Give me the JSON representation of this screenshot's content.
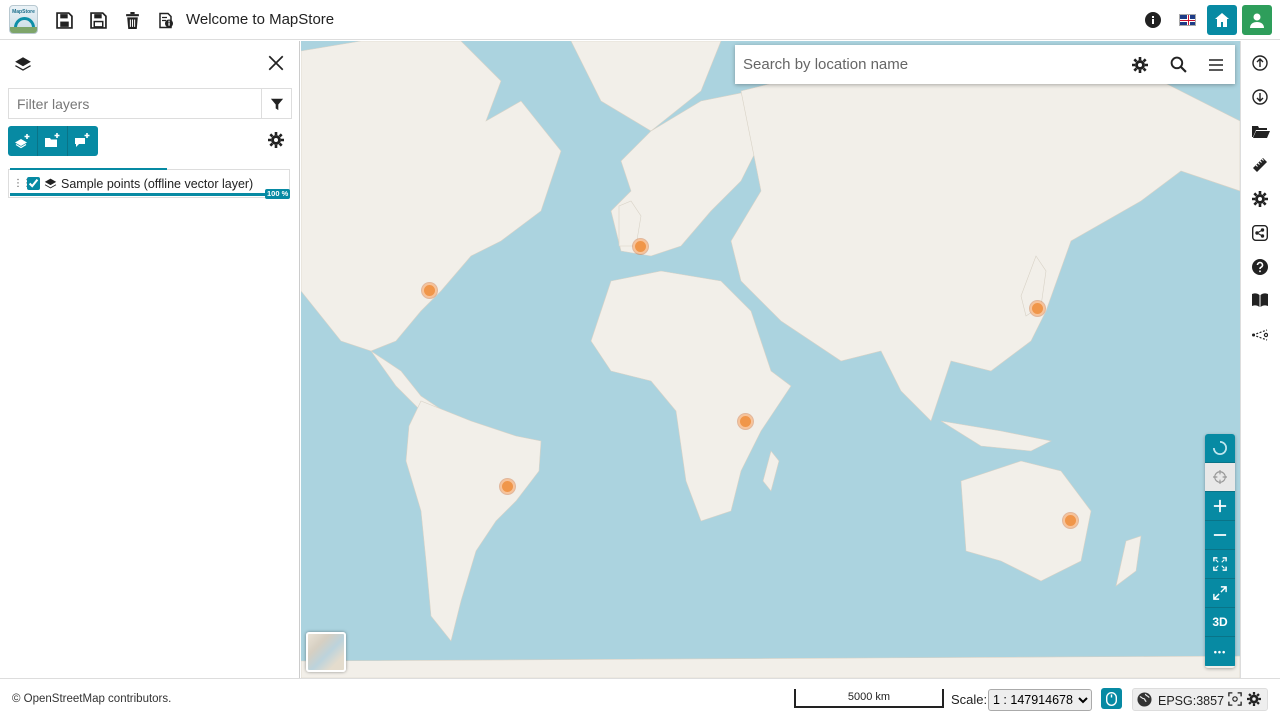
{
  "header": {
    "title": "Welcome to MapStore",
    "logo_text": "MapStore",
    "language": "en-GB"
  },
  "layers_panel": {
    "filter_placeholder": "Filter layers",
    "layers": [
      {
        "name": "Sample points (offline vector layer)",
        "visible": true,
        "load_progress": "100 %"
      }
    ]
  },
  "map": {
    "search_placeholder": "Search by location name",
    "markers": [
      {
        "place": "New York"
      },
      {
        "place": "London"
      },
      {
        "place": "Tokyo"
      },
      {
        "place": "Nairobi"
      },
      {
        "place": "Rio de Janeiro"
      },
      {
        "place": "Sydney"
      }
    ],
    "zoom_controls": {
      "3d_label": "3D",
      "more_label": "•••"
    }
  },
  "footer": {
    "attribution_prefix": "© ",
    "attribution_link": "OpenStreetMap",
    "attribution_suffix": " contributors.",
    "scalebar_label": "5000 km",
    "scale_label": "Scale:",
    "scale_value": "1 : 147914678",
    "crs": "EPSG:3857"
  },
  "colors": {
    "accent": "#078aa3",
    "user_button": "#2e9e5b",
    "marker": "#f0964a",
    "water": "#abd3df",
    "land": "#f2efe9"
  }
}
